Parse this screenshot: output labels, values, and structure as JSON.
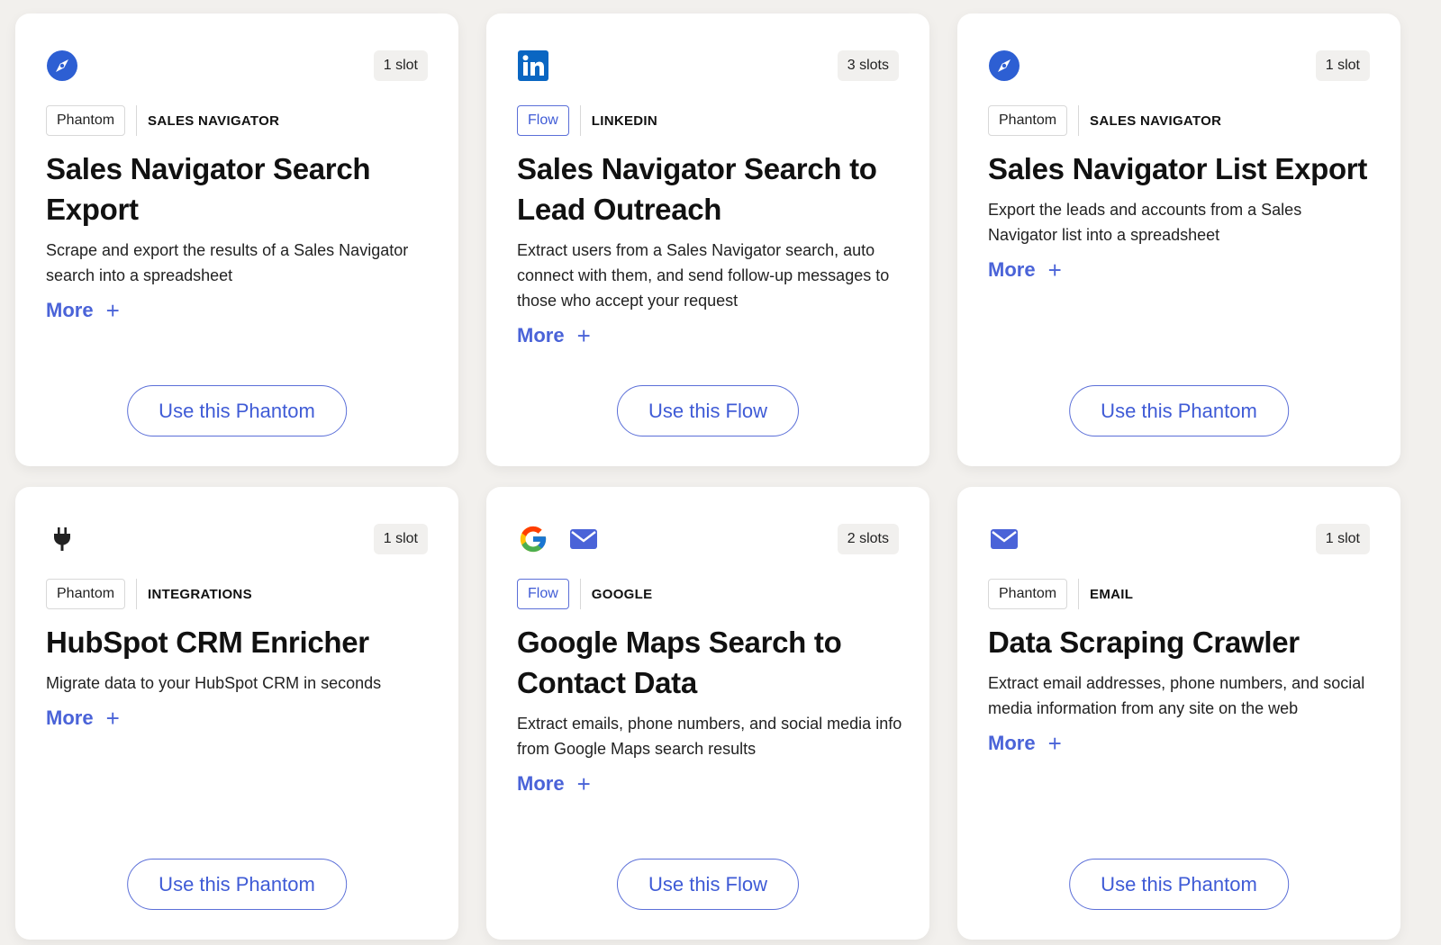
{
  "cards": [
    {
      "slots": "1 slot",
      "icons": [
        "compass-icon"
      ],
      "type": "Phantom",
      "category": "SALES NAVIGATOR",
      "title": "Sales Navigator Search Export",
      "description": "Scrape and export the results of a Sales Navigator search into a spreadsheet",
      "more": "More",
      "more_icon": "+",
      "cta": "Use this Phantom"
    },
    {
      "slots": "3 slots",
      "icons": [
        "linkedin-icon"
      ],
      "type": "Flow",
      "category": "LINKEDIN",
      "title": "Sales Navigator Search to Lead Outreach",
      "description": "Extract users from a Sales Navigator search, auto connect with them, and send follow-up messages to those who accept your request",
      "more": "More",
      "more_icon": "+",
      "cta": "Use this Flow"
    },
    {
      "slots": "1 slot",
      "icons": [
        "compass-icon"
      ],
      "type": "Phantom",
      "category": "SALES NAVIGATOR",
      "title": "Sales Navigator List Export",
      "description": "Export the leads and accounts from a Sales Navigator list into a spreadsheet",
      "more": "More",
      "more_icon": "+",
      "cta": "Use this Phantom"
    },
    {
      "slots": "1 slot",
      "icons": [
        "plug-icon"
      ],
      "type": "Phantom",
      "category": "INTEGRATIONS",
      "title": "HubSpot CRM Enricher",
      "description": "Migrate data to your HubSpot CRM in seconds",
      "more": "More",
      "more_icon": "+",
      "cta": "Use this Phantom"
    },
    {
      "slots": "2 slots",
      "icons": [
        "google-icon",
        "mail-icon"
      ],
      "type": "Flow",
      "category": "GOOGLE",
      "title": "Google Maps Search to Contact Data",
      "description": "Extract emails, phone numbers, and social media info from Google Maps search results",
      "more": "More",
      "more_icon": "+",
      "cta": "Use this Flow"
    },
    {
      "slots": "1 slot",
      "icons": [
        "mail-icon"
      ],
      "type": "Phantom",
      "category": "EMAIL",
      "title": "Data Scraping Crawler",
      "description": "Extract email addresses, phone numbers, and social media information from any site on the web",
      "more": "More",
      "more_icon": "+",
      "cta": "Use this Phantom"
    }
  ],
  "colors": {
    "accent": "#4a63d8",
    "linkedin": "#0a66c2",
    "page_bg": "#f2f0ed"
  }
}
